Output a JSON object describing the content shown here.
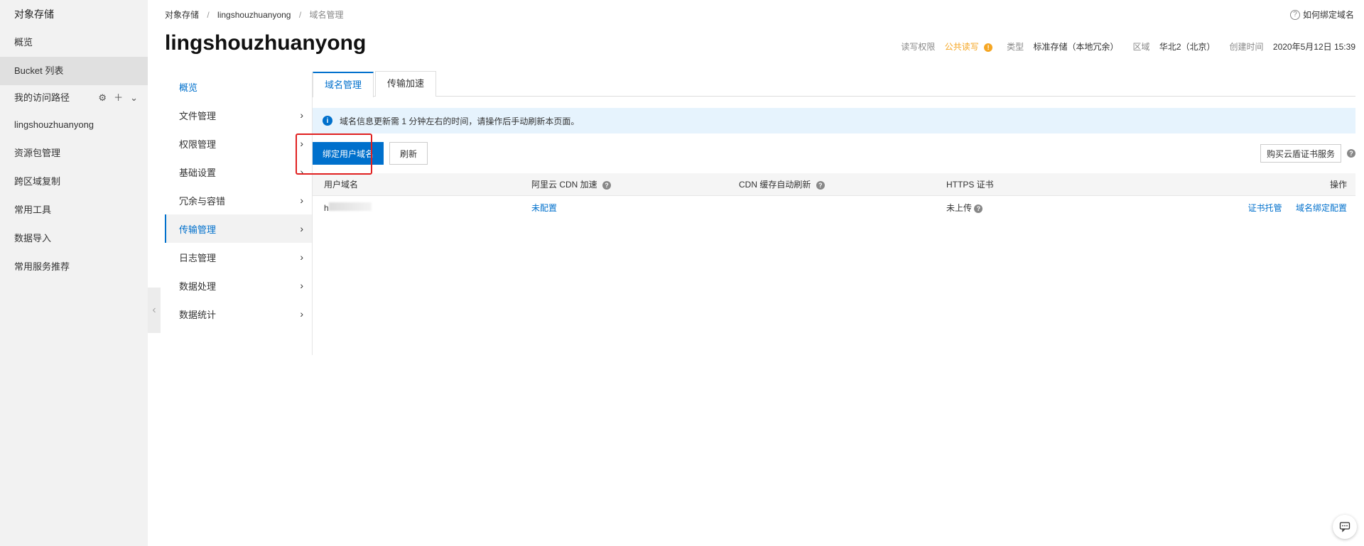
{
  "sidebar": {
    "brand": "对象存储",
    "items": [
      {
        "label": "概览"
      },
      {
        "label": "Bucket 列表"
      }
    ],
    "path_label": "我的访问路径",
    "path_bucket": "lingshouzhuanyong",
    "items2": [
      {
        "label": "资源包管理"
      },
      {
        "label": "跨区域复制"
      },
      {
        "label": "常用工具"
      },
      {
        "label": "数据导入"
      },
      {
        "label": "常用服务推荐"
      }
    ]
  },
  "breadcrumb": {
    "root": "对象存储",
    "bucket": "lingshouzhuanyong",
    "current": "域名管理",
    "sep": "/"
  },
  "help": {
    "label": "如何绑定域名"
  },
  "page_title": "lingshouzhuanyong",
  "meta": {
    "perm_key": "读写权限",
    "perm_val": "公共读写",
    "type_key": "类型",
    "type_val": "标准存储（本地冗余）",
    "region_key": "区域",
    "region_val": "华北2（北京）",
    "created_key": "创建时间",
    "created_val": "2020年5月12日 15:39"
  },
  "subnav": [
    {
      "label": "概览"
    },
    {
      "label": "文件管理"
    },
    {
      "label": "权限管理"
    },
    {
      "label": "基础设置"
    },
    {
      "label": "冗余与容错"
    },
    {
      "label": "传输管理"
    },
    {
      "label": "日志管理"
    },
    {
      "label": "数据处理"
    },
    {
      "label": "数据统计"
    }
  ],
  "tabs": [
    {
      "label": "域名管理"
    },
    {
      "label": "传输加速"
    }
  ],
  "notice": "域名信息更新需 1 分钟左右的时间，请操作后手动刷新本页面。",
  "toolbar": {
    "bind_label": "绑定用户域名",
    "refresh_label": "刷新",
    "buy_label": "购买云盾证书服务"
  },
  "table": {
    "headers": [
      "用户域名",
      "阿里云 CDN 加速",
      "CDN 缓存自动刷新",
      "HTTPS 证书",
      "操作"
    ],
    "row": {
      "domain_prefix": "h",
      "cdn": "未配置",
      "https": "未上传",
      "action1": "证书托管",
      "action2": "域名绑定配置"
    }
  },
  "colors": {
    "accent": "#0070cc",
    "warn": "#f5a623",
    "highlight": "#e02020"
  }
}
